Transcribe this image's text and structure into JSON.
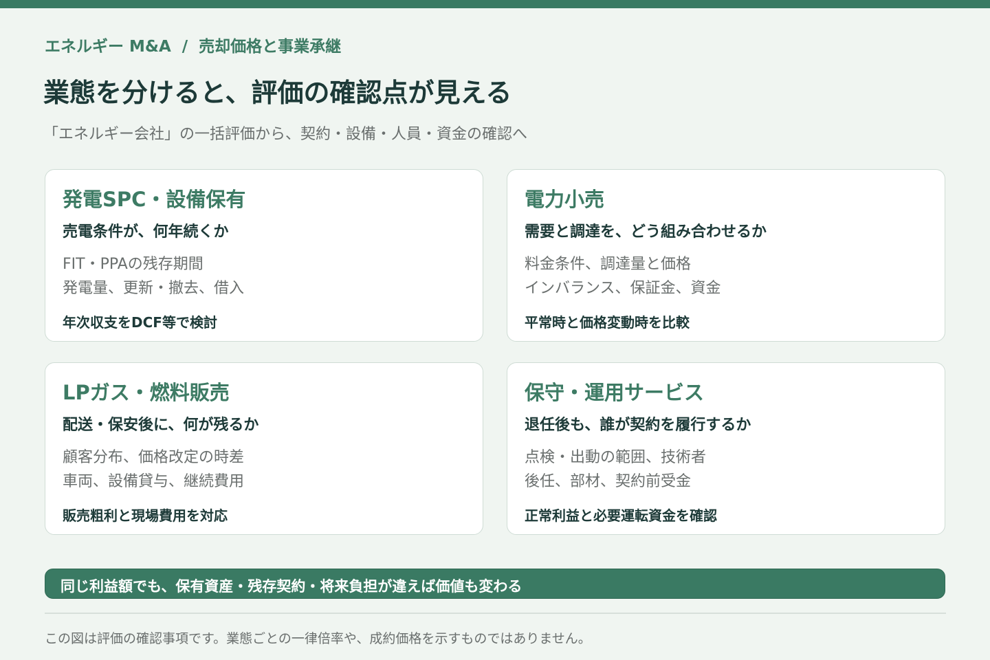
{
  "breadcrumb": {
    "section": "エネルギー M&A",
    "separator": "/",
    "topic": "売却価格と事業承継"
  },
  "page_title": "業態を分けると、評価の確認点が見える",
  "subtitle": "「エネルギー会社」の一括評価から、契約・設備・人員・資金の確認へ",
  "cards": [
    {
      "title": "発電SPC・設備保有",
      "question": "売電条件が、何年続くか",
      "details": [
        "FIT・PPAの残存期間",
        "発電量、更新・撤去、借入"
      ],
      "method": "年次収支をDCF等で検討"
    },
    {
      "title": "電力小売",
      "question": "需要と調達を、どう組み合わせるか",
      "details": [
        "料金条件、調達量と価格",
        "インバランス、保証金、資金"
      ],
      "method": "平常時と価格変動時を比較"
    },
    {
      "title": "LPガス・燃料販売",
      "question": "配送・保安後に、何が残るか",
      "details": [
        "顧客分布、価格改定の時差",
        "車両、設備貸与、継続費用"
      ],
      "method": "販売粗利と現場費用を対応"
    },
    {
      "title": "保守・運用サービス",
      "question": "退任後も、誰が契約を履行するか",
      "details": [
        "点検・出動の範囲、技術者",
        "後任、部材、契約前受金"
      ],
      "method": "正常利益と必要運転資金を確認"
    }
  ],
  "banner": {
    "text": "同じ利益額でも、保有資産・残存契約・将来負担が違えば価値も変わる"
  },
  "footnote": "この図は評価の確認事項です。業態ごとの一律倍率や、成約価格を示すものではありません。",
  "colors": {
    "accent": "#3a7a63",
    "title_text": "#1d3a38",
    "muted_text": "#6a6f6e",
    "background": "#f0f5f1",
    "card_border": "#cfdcd5"
  }
}
